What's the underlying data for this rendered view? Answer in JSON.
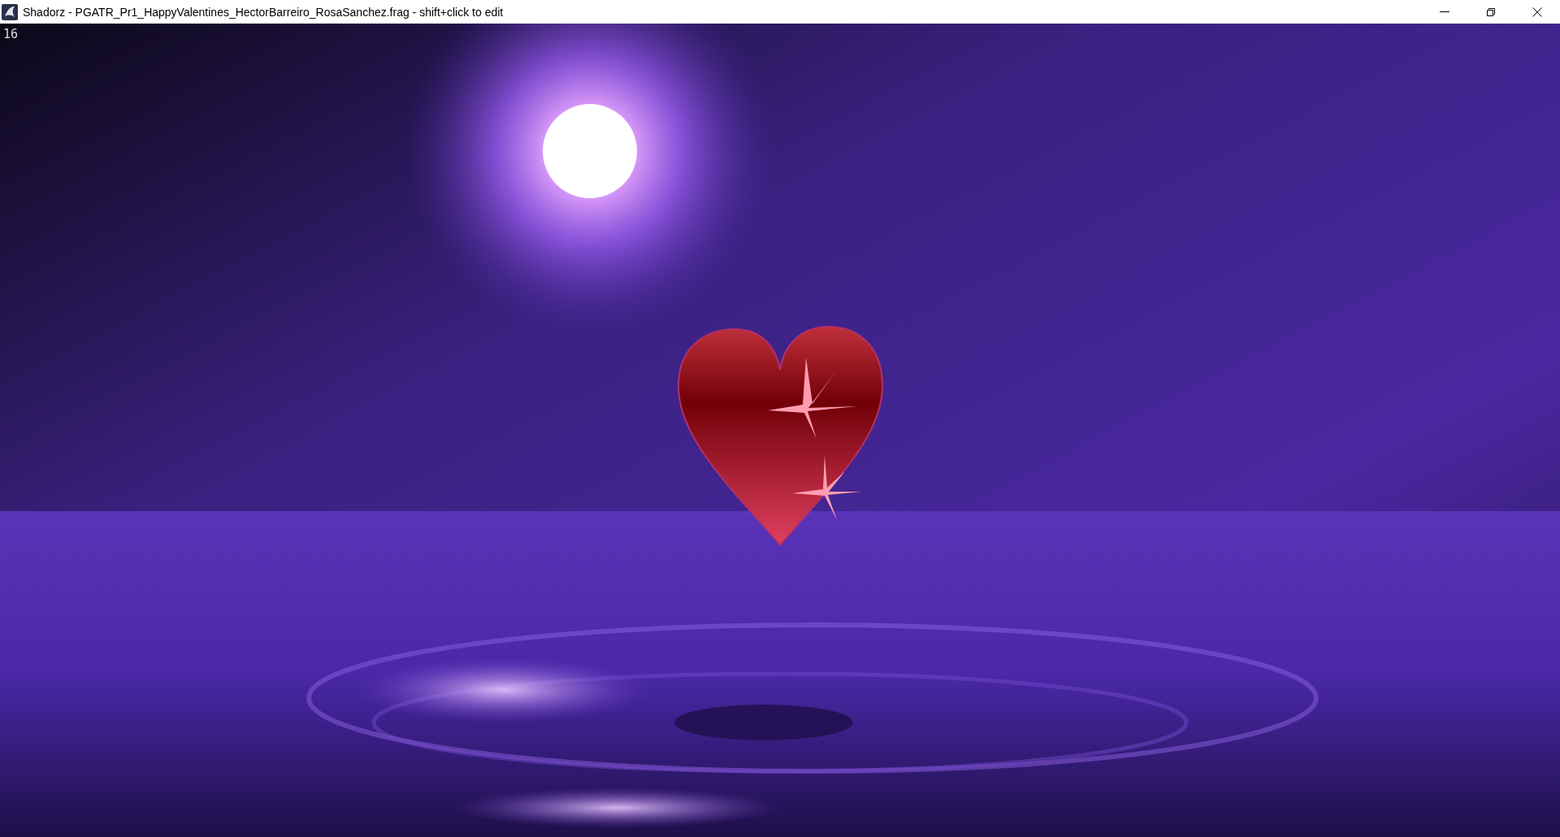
{
  "window": {
    "title": "Shadorz - PGATR_Pr1_HappyValentines_HectorBarreiro_RosaSanchez.frag - shift+click to edit"
  },
  "viewport": {
    "fps_counter": "16"
  }
}
